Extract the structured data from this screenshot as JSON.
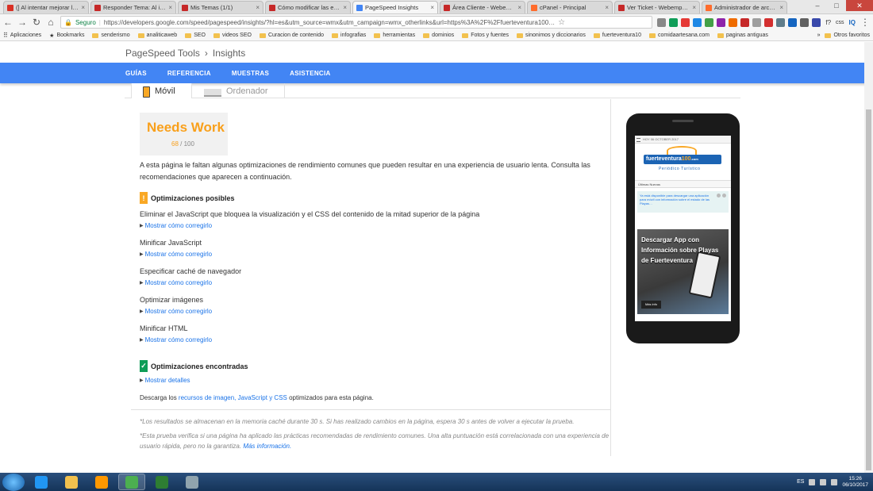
{
  "browser": {
    "tabs": [
      {
        "label": "(] Al intentar mejorar la…",
        "color": "#d93025"
      },
      {
        "label": "Responder Tema: Al inte…",
        "color": "#c62828"
      },
      {
        "label": "Mis Temas (1/1)",
        "color": "#c62828"
      },
      {
        "label": "Cómo modificar las etiq…",
        "color": "#c62828"
      },
      {
        "label": "PageSpeed Insights",
        "color": "#4285f4"
      },
      {
        "label": "Área Cliente - Webemp…",
        "color": "#c62828"
      },
      {
        "label": "cPanel - Principal",
        "color": "#ff6c2c"
      },
      {
        "label": "Ver Ticket - Webempre…",
        "color": "#c62828"
      },
      {
        "label": "Administrador de archi…",
        "color": "#ff6c2c"
      }
    ],
    "tab_close": "×",
    "window_controls": {
      "minimize": "–",
      "maximize": "□",
      "close": "✕"
    },
    "nav": {
      "back": "←",
      "forward": "→",
      "reload": "↻",
      "home": "⌂"
    },
    "secure_label": "Seguro",
    "url": "https://developers.google.com/speed/pagespeed/insights/?hl=es&utm_source=wmx&utm_campaign=wmx_otherlinks&url=https%3A%2F%2Ffuerteventura100…",
    "extension_colors": [
      "#888888",
      "#0f9d58",
      "#e53935",
      "#1e88e5",
      "#43a047",
      "#8e24aa",
      "#ef6c00",
      "#c62828",
      "#9e9e9e",
      "#d32f2f",
      "#607d8b",
      "#1565c0",
      "#616161",
      "#3949ab"
    ],
    "ext_text": [
      "f?",
      "css",
      "IQ"
    ],
    "menu": "⋮"
  },
  "bookmarks": {
    "apps": "Aplicaciones",
    "items": [
      "Bookmarks",
      "senderismo",
      "analiticaweb",
      "SEO",
      "videos SEO",
      "Curacion de contenido",
      "infografias",
      "herramientas",
      "dominios",
      "Fotos y fuentes",
      "sinonimos y diccionarios",
      "fuerteventura10",
      "comidaartesana.com",
      "paginas antiguas"
    ],
    "more": "»",
    "other": "Otros favoritos"
  },
  "page": {
    "breadcrumb": {
      "root": "PageSpeed Tools",
      "sep": "›",
      "current": "Insights"
    },
    "nav": [
      "GUÍAS",
      "REFERENCIA",
      "MUESTRAS",
      "ASISTENCIA"
    ],
    "device_tabs": {
      "mobile": "Móvil",
      "desktop": "Ordenador"
    },
    "score": {
      "title": "Needs Work",
      "value": "68",
      "sep": " / ",
      "max": "100"
    },
    "intro": "A esta página le faltan algunas optimizaciones de rendimiento comunes que pueden resultar en una experiencia de usuario lenta. Consulta las recomendaciones que aparecen a continuación.",
    "possible": {
      "badge": "!",
      "heading": "Optimizaciones posibles",
      "link_label": "Mostrar cómo corregirlo",
      "rules": [
        "Eliminar el JavaScript que bloquea la visualización y el CSS del contenido de la mitad superior de la página",
        "Minificar JavaScript",
        "Especificar caché de navegador",
        "Optimizar imágenes",
        "Minificar HTML"
      ]
    },
    "found": {
      "badge": "✓",
      "heading": "Optimizaciones encontradas",
      "link_label": "Mostrar detalles"
    },
    "download": {
      "before": "Descarga los ",
      "link": "recursos de imagen, JavaScript y CSS",
      "after": " optimizados para esta página."
    },
    "note1": "*Los resultados se almacenan en la memoria caché durante 30 s. Si has realizado cambios en la página, espera 30 s antes de volver a ejecutar la prueba.",
    "note2": "*Esta prueba verifica si una página ha aplicado las prácticas recomendadas de rendimiento comunes. Una alta puntuación está correlacionada con una experiencia de usuario rápida, pero no la garantiza. ",
    "note2_link": "Más información."
  },
  "preview": {
    "date": "HOY 06 OCTOBER 2017",
    "logo_main": "fuerteventura",
    "logo_accent": "100",
    "logo_tld": ".com",
    "logo_sub": "Periódico Turístico",
    "tab": "Últimas Nuevas",
    "notice": "Ya está disponible para descargar una aplicación para móvil con información sobre el estado de las Playas…",
    "banner": "Descargar App con Información sobre Playas de Fuerteventura",
    "banner_btn": "Más info"
  },
  "taskbar": {
    "apps": [
      {
        "name": "internet-explorer",
        "color": "#2196f3"
      },
      {
        "name": "file-explorer",
        "color": "#f2c14e"
      },
      {
        "name": "media-player",
        "color": "#ff9800"
      },
      {
        "name": "chrome",
        "color": "#4caf50"
      },
      {
        "name": "excel",
        "color": "#2e7d32"
      },
      {
        "name": "notepad",
        "color": "#90a4ae"
      }
    ],
    "lang": "ES",
    "time": "15:26",
    "date": "06/10/2017"
  }
}
